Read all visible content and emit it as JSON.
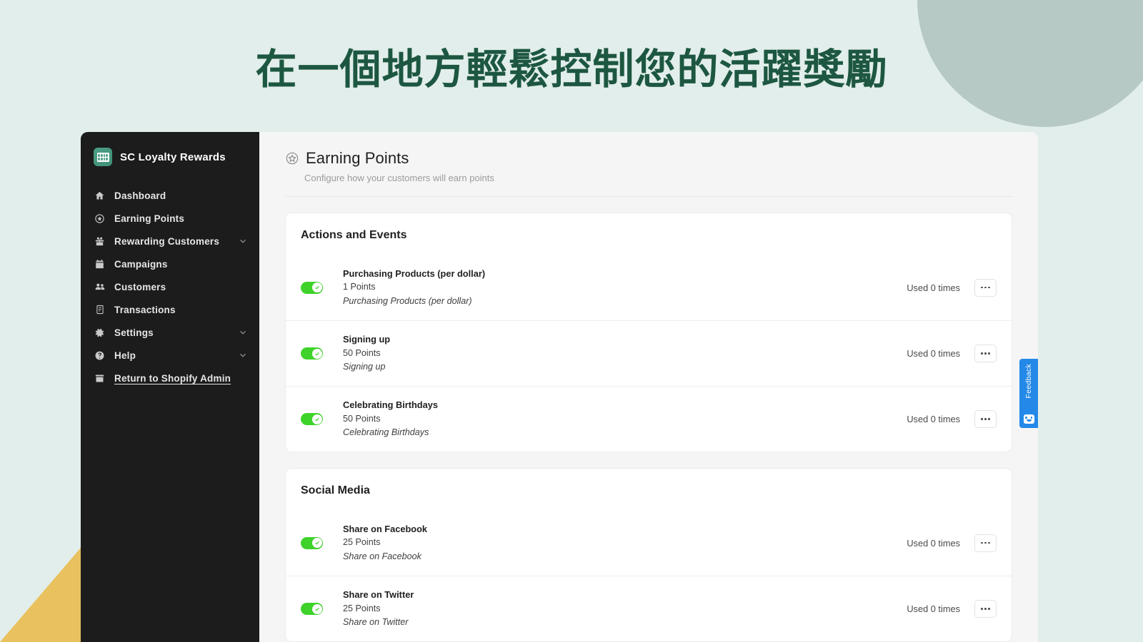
{
  "headline": "在一個地方輕鬆控制您的活躍獎勵",
  "colors": {
    "page_background": "#e2eeeb",
    "headline": "#1d5741",
    "deco_circle": "#b6c9c4",
    "deco_triangle": "#e9c15f",
    "sidebar_background": "#1c1c1c",
    "toggle_on": "#3ed22a",
    "feedback_tab": "#2388e8",
    "brand_logo": "#4e9f86"
  },
  "sidebar": {
    "brand": {
      "name": "SC Loyalty Rewards",
      "icon": "app-logo-icon"
    },
    "items": [
      {
        "label": "Dashboard",
        "icon": "home-icon",
        "chevron": false
      },
      {
        "label": "Earning Points",
        "icon": "star-circle-icon",
        "chevron": false
      },
      {
        "label": "Rewarding Customers",
        "icon": "gift-icon",
        "chevron": true
      },
      {
        "label": "Campaigns",
        "icon": "calendar-icon",
        "chevron": false
      },
      {
        "label": "Customers",
        "icon": "people-icon",
        "chevron": false
      },
      {
        "label": "Transactions",
        "icon": "document-icon",
        "chevron": false
      },
      {
        "label": "Settings",
        "icon": "gear-icon",
        "chevron": true
      },
      {
        "label": "Help",
        "icon": "help-circle-icon",
        "chevron": true
      },
      {
        "label": "Return to Shopify Admin",
        "icon": "store-icon",
        "chevron": false,
        "underline": true
      }
    ]
  },
  "page": {
    "title": "Earning Points",
    "title_icon": "star-circle-icon",
    "subtitle": "Configure how your customers will earn points"
  },
  "cards": [
    {
      "title": "Actions and Events",
      "rows": [
        {
          "title": "Purchasing Products (per dollar)",
          "points": "1 Points",
          "description": "Purchasing Products (per dollar)",
          "used": "Used 0 times",
          "enabled": true
        },
        {
          "title": "Signing up",
          "points": "50 Points",
          "description": "Signing up",
          "used": "Used 0 times",
          "enabled": true
        },
        {
          "title": "Celebrating Birthdays",
          "points": "50 Points",
          "description": "Celebrating Birthdays",
          "used": "Used 0 times",
          "enabled": true
        }
      ]
    },
    {
      "title": "Social Media",
      "rows": [
        {
          "title": "Share on Facebook",
          "points": "25 Points",
          "description": "Share on Facebook",
          "used": "Used 0 times",
          "enabled": true
        },
        {
          "title": "Share on Twitter",
          "points": "25 Points",
          "description": "Share on Twitter",
          "used": "Used 0 times",
          "enabled": true
        }
      ]
    }
  ],
  "feedback": {
    "label": "Feedback",
    "icon": "smiley-face-icon"
  }
}
